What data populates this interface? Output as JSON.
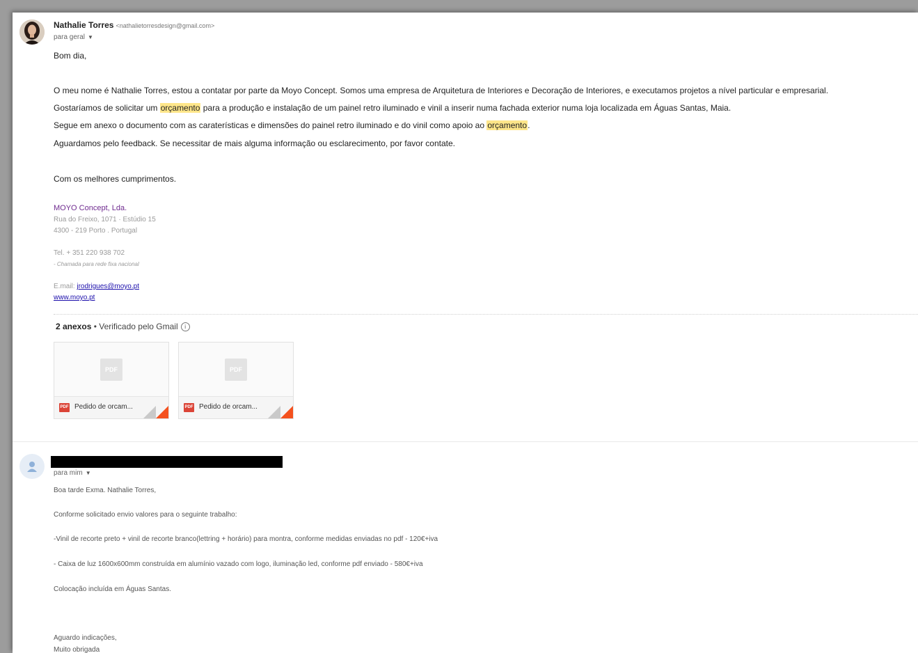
{
  "message1": {
    "sender_name": "Nathalie Torres",
    "sender_email": "<nathalietorresdesign@gmail.com>",
    "to_label": "para geral",
    "greeting": "Bom dia,",
    "para1": "O meu nome é Nathalie Torres, estou a contatar por parte da Moyo Concept.  Somos uma empresa de Arquitetura de Interiores e Decoração de Interiores, e executamos projetos a nível particular e empresarial.",
    "para2_before": "Gostaríamos de solicitar um ",
    "highlight_word": "orçamento",
    "para2_after": " para a produção e instalação de um painel retro iluminado e vinil a inserir numa fachada exterior numa loja localizada em Águas Santas, Maia.",
    "para3_before": "Segue em anexo o documento com as caraterísticas e dimensões do painel retro iluminado e do vinil como apoio ao ",
    "para3_after": ".",
    "para4": "Aguardamos pelo feedback. Se necessitar de mais alguma informação ou esclarecimento, por favor contate.",
    "closing": "Com os melhores cumprimentos.",
    "signature": {
      "company": "MOYO Concept, Lda.",
      "address1": "Rua do Freixo, 1071 · Estúdio 15",
      "address2": "4300 - 219 Porto . Portugal",
      "tel": "Tel. + 351 220 938 702",
      "tel_note": "- Chamada para rede fixa nacional",
      "email_label": "E.mail: ",
      "email": "jrodrigues@moyo.pt",
      "website": "www.moyo.pt"
    },
    "attachments_count": "2 anexos",
    "attachments_verified": " • Verificado pelo Gmail",
    "info_icon_glyph": "i",
    "attachments": [
      {
        "name": "Pedido de orcam...",
        "type": "PDF",
        "icon": "pdf-icon"
      },
      {
        "name": "Pedido de orcam...",
        "type": "PDF",
        "icon": "pdf-icon"
      }
    ],
    "pdf_small_label": "PDF"
  },
  "message2": {
    "to_label": "para mim",
    "lines": [
      "Boa tarde Exma. Nathalie Torres,",
      "Conforme solicitado envio valores para o seguinte trabalho:",
      "-Vinil de recorte preto + vinil de recorte branco(lettring + horário) para montra, conforme medidas enviadas no pdf - 120€+iva",
      "- Caixa de luz 1600x600mm construída em alumínio vazado com logo, iluminação led, conforme pdf enviado - 580€+iva",
      "Colocação incluída em Águas Santas.",
      "Aguardo indicações,",
      "Muito obrigada"
    ]
  },
  "colors": {
    "highlight": "#ffe68a",
    "signature_company": "#6f2b8f",
    "link": "#1a0dab",
    "pdf_red": "#db4437",
    "fold_orange": "#f4511e"
  },
  "caret_glyph": "▼"
}
